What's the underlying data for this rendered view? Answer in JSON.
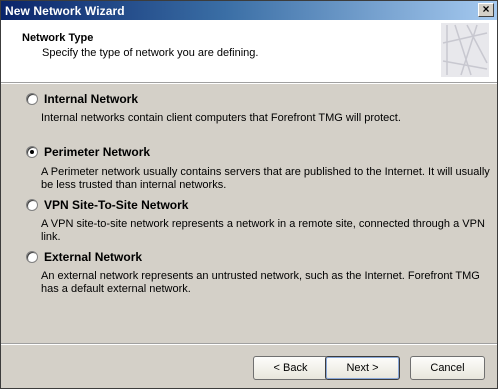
{
  "window": {
    "title": "New Network Wizard",
    "close_label": "×"
  },
  "header": {
    "title": "Network Type",
    "subtitle": "Specify the type of network you are defining."
  },
  "options": [
    {
      "label": "Internal Network",
      "description": "Internal networks contain client computers that Forefront TMG will protect.",
      "selected": false
    },
    {
      "label": "Perimeter Network",
      "description": "A Perimeter network usually contains servers that are published to the Internet. It will usually be less trusted than internal networks.",
      "selected": true
    },
    {
      "label": "VPN Site-To-Site Network",
      "description": "A VPN site-to-site network represents a network in a remote site, connected through a VPN link.",
      "selected": false
    },
    {
      "label": "External Network",
      "description": "An external network represents an untrusted network, such as the Internet. Forefront TMG has a default external network.",
      "selected": false
    }
  ],
  "buttons": {
    "back": "< Back",
    "next": "Next >",
    "cancel": "Cancel"
  }
}
